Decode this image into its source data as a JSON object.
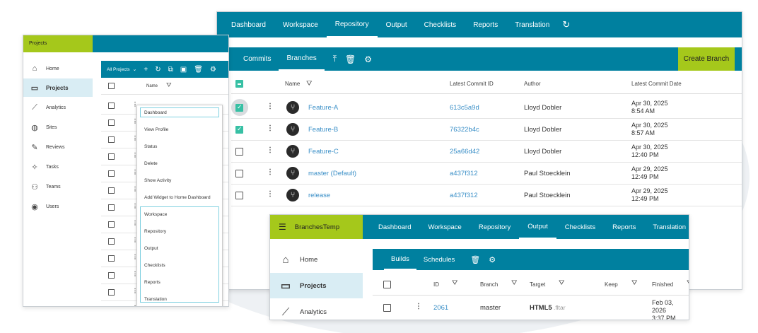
{
  "repo_window": {
    "top_nav": [
      {
        "label": "Dashboard",
        "active": false
      },
      {
        "label": "Workspace",
        "active": false
      },
      {
        "label": "Repository",
        "active": true
      },
      {
        "label": "Output",
        "active": false
      },
      {
        "label": "Checklists",
        "active": false
      },
      {
        "label": "Reports",
        "active": false
      },
      {
        "label": "Translation",
        "active": false
      }
    ],
    "sub_tabs": [
      {
        "label": "Commits",
        "active": false
      },
      {
        "label": "Branches",
        "active": true
      }
    ],
    "create_branch_label": "Create Branch",
    "columns": {
      "name": "Name",
      "commit_id": "Latest Commit ID",
      "author": "Author",
      "date": "Latest Commit Date"
    },
    "branches": [
      {
        "name": "Feature-A",
        "commit_id": "613c5a9d",
        "author": "Lloyd Dobler",
        "date": "Apr 30, 2025",
        "time": "8:54 AM",
        "checked": true
      },
      {
        "name": "Feature-B",
        "commit_id": "76322b4c",
        "author": "Lloyd Dobler",
        "date": "Apr 30, 2025",
        "time": "8:57 AM",
        "checked": true
      },
      {
        "name": "Feature-C",
        "commit_id": "25a66d42",
        "author": "Lloyd Dobler",
        "date": "Apr 30, 2025",
        "time": "12:40 PM",
        "checked": false
      },
      {
        "name": "master (Default)",
        "commit_id": "a437f312",
        "author": "Paul Stoecklein",
        "date": "Apr 29, 2025",
        "time": "12:49 PM",
        "checked": false
      },
      {
        "name": "release",
        "commit_id": "a437f312",
        "author": "Paul Stoecklein",
        "date": "Apr 29, 2025",
        "time": "12:49 PM",
        "checked": false
      }
    ]
  },
  "projects_window": {
    "title": "Projects",
    "sidebar": [
      {
        "label": "Home",
        "icon": "home-icon",
        "active": false
      },
      {
        "label": "Projects",
        "icon": "folder-icon",
        "active": true
      },
      {
        "label": "Analytics",
        "icon": "analytics-icon",
        "active": false
      },
      {
        "label": "Sites",
        "icon": "globe-icon",
        "active": false
      },
      {
        "label": "Reviews",
        "icon": "review-icon",
        "active": false
      },
      {
        "label": "Tasks",
        "icon": "pin-icon",
        "active": false
      },
      {
        "label": "Teams",
        "icon": "teams-icon",
        "active": false
      },
      {
        "label": "Users",
        "icon": "user-icon",
        "active": false
      }
    ],
    "filter_label": "All Projects",
    "name_column": "Name",
    "context_menu": {
      "group1": [
        "Dashboard",
        "View Profile",
        "Status",
        "Delete",
        "Show Activity",
        "Add Widget to Home Dashboard"
      ],
      "group2": [
        "Workspace",
        "Repository",
        "Output",
        "Checklists",
        "Reports",
        "Translation"
      ]
    }
  },
  "builds_window": {
    "project_name": "BranchesTemp",
    "top_nav": [
      {
        "label": "Dashboard",
        "active": false
      },
      {
        "label": "Workspace",
        "active": false
      },
      {
        "label": "Repository",
        "active": false
      },
      {
        "label": "Output",
        "active": true
      },
      {
        "label": "Checklists",
        "active": false
      },
      {
        "label": "Reports",
        "active": false
      },
      {
        "label": "Translation",
        "active": false
      }
    ],
    "sidebar": [
      {
        "label": "Home",
        "icon": "home-icon",
        "active": false
      },
      {
        "label": "Projects",
        "icon": "folder-icon",
        "active": true
      },
      {
        "label": "Analytics",
        "icon": "analytics-icon",
        "active": false
      }
    ],
    "sub_tabs": [
      {
        "label": "Builds",
        "active": true
      },
      {
        "label": "Schedules",
        "active": false
      }
    ],
    "columns": {
      "id": "ID",
      "branch": "Branch",
      "target": "Target",
      "keep": "Keep",
      "finished": "Finished"
    },
    "rows": [
      {
        "id": "2061",
        "branch": "master",
        "target": "HTML5",
        "target_ext": ".fltar",
        "date": "Feb 03, 2026",
        "time": "3:37 PM"
      }
    ]
  }
}
